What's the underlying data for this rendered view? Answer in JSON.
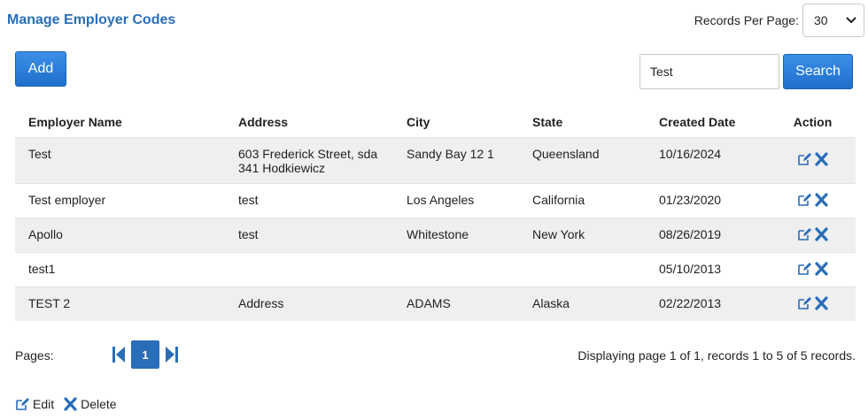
{
  "page": {
    "title": "Manage Employer Codes"
  },
  "records_per_page": {
    "label": "Records Per Page:",
    "value": "30"
  },
  "toolbar": {
    "add_label": "Add",
    "search_value": "Test",
    "search_label": "Search"
  },
  "table": {
    "headers": [
      "Employer Name",
      "Address",
      "City",
      "State",
      "Created Date",
      "Action"
    ],
    "rows": [
      {
        "name": "Test",
        "address": "603 Frederick Street, sda 341 Hodkiewicz",
        "city": "Sandy Bay 12 1",
        "state": "Queensland",
        "created": "10/16/2024"
      },
      {
        "name": "Test employer",
        "address": "test",
        "city": "Los Angeles",
        "state": "California",
        "created": "01/23/2020"
      },
      {
        "name": "Apollo",
        "address": "test",
        "city": "Whitestone",
        "state": "New York",
        "created": "08/26/2019"
      },
      {
        "name": "test1",
        "address": "",
        "city": "",
        "state": "",
        "created": "05/10/2013"
      },
      {
        "name": "TEST 2",
        "address": "Address",
        "city": "ADAMS",
        "state": "Alaska",
        "created": "02/22/2013"
      }
    ]
  },
  "pagination": {
    "label": "Pages:",
    "current_page": "1",
    "summary": "Displaying page 1 of 1, records 1 to 5 of 5 records."
  },
  "legend": {
    "edit_label": "Edit",
    "delete_label": "Delete"
  },
  "colors": {
    "accent": "#2a6db8",
    "button": "#1f6fcc",
    "row_alt": "#efefef"
  },
  "icons": {
    "edit": "edit-icon",
    "delete": "delete-icon",
    "first": "first-page-icon",
    "last": "last-page-icon",
    "chevron": "chevron-down-icon"
  }
}
